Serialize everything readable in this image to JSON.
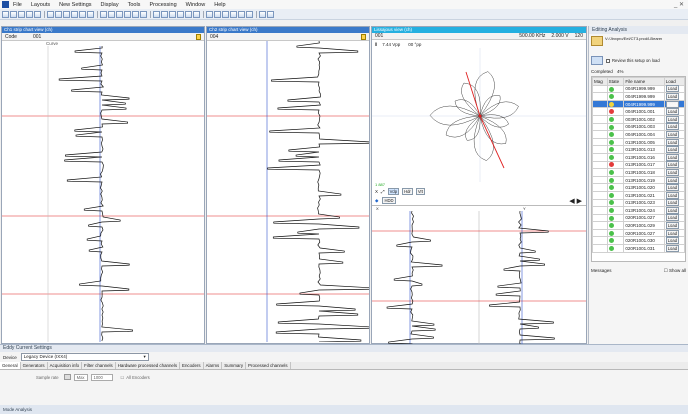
{
  "menu": [
    "File",
    "Layouts",
    "New Settings",
    "Display",
    "Tools",
    "Processing",
    "Window",
    "Help"
  ],
  "window_controls": "_ ✕",
  "pane1": {
    "title": "Ch1 strip chart view (ch)",
    "code_label": "Code",
    "channel": "001",
    "sub_label": "Curve"
  },
  "pane2": {
    "title": "Ch2 strip chart view (ch)",
    "channel": "004"
  },
  "pane3": {
    "title": "Lissajous view (ch)",
    "channel": "001",
    "freq": "500.00 KHz",
    "volt": "2.000 V",
    "angle": "120",
    "gain": "7.44 Vpp",
    "phase": "00 °pp",
    "point_label": "1 887",
    "buttons": [
      "Vdp",
      "Hdr",
      "Vrt"
    ],
    "hdd_label": "HDD",
    "mini_labels": [
      "X",
      "Y"
    ]
  },
  "right_panel": {
    "title": "Editing Analysis",
    "path": "V:/Jinxpro/Eel/CT3.prcd/LBearer",
    "review_label": "Review this setup on load",
    "completed_label": "Completed",
    "completed_value": "4%",
    "headers": [
      "Mag",
      "State",
      "File name",
      "Load"
    ],
    "files": [
      {
        "state": "green",
        "name": "004R1999.999",
        "load": "Load"
      },
      {
        "state": "green",
        "name": "004R1999.999",
        "load": "Load"
      },
      {
        "state": "yellow",
        "name": "004R1999.999",
        "load": "Load",
        "selected": true
      },
      {
        "state": "red",
        "name": "004R1001.001",
        "load": "Load"
      },
      {
        "state": "green",
        "name": "003R1001.002",
        "load": "Load"
      },
      {
        "state": "green",
        "name": "004R1001.003",
        "load": "Load"
      },
      {
        "state": "green",
        "name": "004R1001.004",
        "load": "Load"
      },
      {
        "state": "green",
        "name": "013R1001.005",
        "load": "Load"
      },
      {
        "state": "green",
        "name": "013R1001.013",
        "load": "Load"
      },
      {
        "state": "green",
        "name": "013R1001.016",
        "load": "Load"
      },
      {
        "state": "red",
        "name": "013R1001.017",
        "load": "Load"
      },
      {
        "state": "green",
        "name": "013R1001.018",
        "load": "Load"
      },
      {
        "state": "green",
        "name": "013R1001.019",
        "load": "Load"
      },
      {
        "state": "green",
        "name": "013R1001.020",
        "load": "Load"
      },
      {
        "state": "green",
        "name": "013R1001.021",
        "load": "Load"
      },
      {
        "state": "green",
        "name": "013R1001.023",
        "load": "Load"
      },
      {
        "state": "green",
        "name": "013R1001.024",
        "load": "Load"
      },
      {
        "state": "green",
        "name": "020R1001.027",
        "load": "Load"
      },
      {
        "state": "green",
        "name": "020R1001.029",
        "load": "Load"
      },
      {
        "state": "green",
        "name": "020R1001.027",
        "load": "Load"
      },
      {
        "state": "green",
        "name": "020R1001.030",
        "load": "Load"
      },
      {
        "state": "green",
        "name": "020R1001.031",
        "load": "Load"
      }
    ],
    "messages_label": "Messages",
    "show_all_label": "Show all"
  },
  "bottom": {
    "title": "Eddy Current Settings",
    "device_label": "Device",
    "device_value": "Legacy Device (IXX4)",
    "tabs": [
      "General",
      "Generators",
      "Acquisition info",
      "Filter channels",
      "Hardware processed channels",
      "Encoders",
      "Alarms",
      "Summary",
      "Processed channels"
    ],
    "sample_rate_label": "Sample rate",
    "rate_mode": "Max",
    "rate_value": "1000",
    "all_encoders_label": "All Encoders",
    "footer": "Mode Analysis"
  },
  "colors": {
    "accent": "#3a79c9",
    "cursor_red": "#e02020",
    "cursor_blue": "#3355cc",
    "trace": "#111111"
  }
}
